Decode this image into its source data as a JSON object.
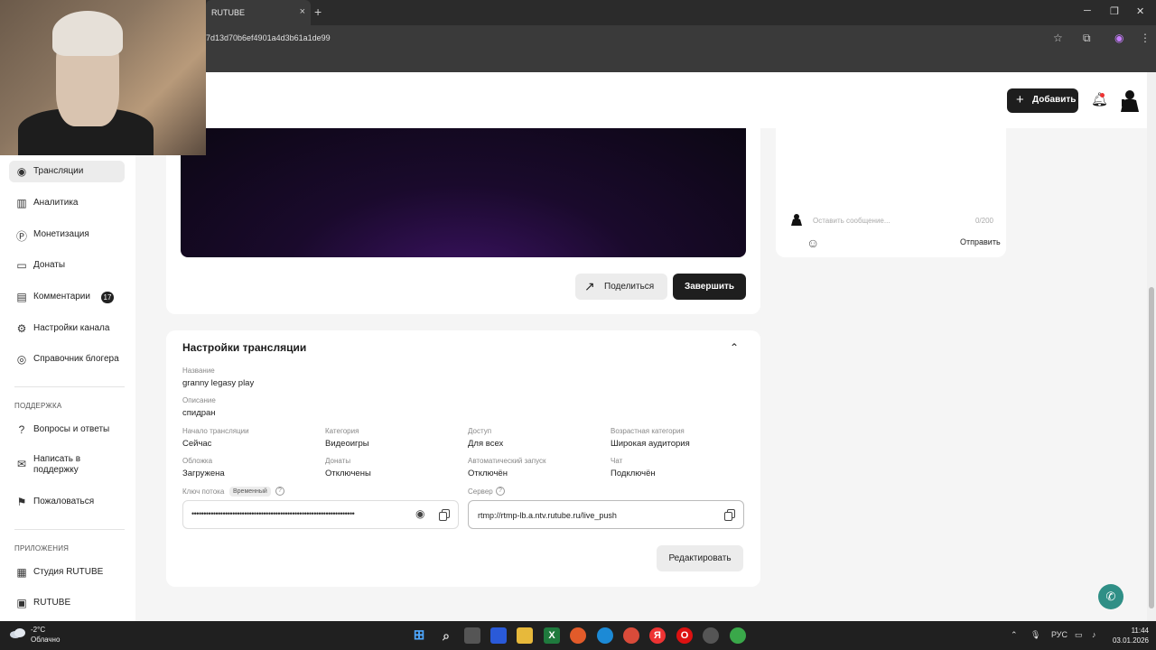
{
  "browser": {
    "tab_title": "RUTUBE",
    "url": "7d13d70b6ef4901a4d3b61a1de99",
    "new_tab": "+",
    "close_tab": "×",
    "minimize": "─",
    "maximize": "❐",
    "close_window": "✕"
  },
  "header": {
    "add_label": "Добавить"
  },
  "sidebar": {
    "items": [
      {
        "label": "Трансляции",
        "icon": "broadcast-icon"
      },
      {
        "label": "Аналитика",
        "icon": "chart-icon"
      },
      {
        "label": "Монетизация",
        "icon": "coin-icon"
      },
      {
        "label": "Донаты",
        "icon": "wallet-icon"
      },
      {
        "label": "Комментарии",
        "icon": "comment-icon",
        "badge": "17"
      },
      {
        "label": "Настройки канала",
        "icon": "gear-icon"
      },
      {
        "label": "Справочник блогера",
        "icon": "book-icon"
      }
    ],
    "support_section": "ПОДДЕРЖКА",
    "support_items": [
      {
        "label": "Вопросы и ответы",
        "icon": "question-icon"
      },
      {
        "label": "Написать в поддержку",
        "icon": "mail-icon"
      },
      {
        "label": "Пожаловаться",
        "icon": "flag-icon"
      }
    ],
    "apps_section": "ПРИЛОЖЕНИЯ",
    "apps_items": [
      {
        "label": "Студия RUTUBE",
        "icon": "grid-icon"
      },
      {
        "label": "RUTUBE",
        "icon": "play-icon"
      }
    ]
  },
  "player": {
    "share_label": "Поделиться",
    "finish_label": "Завершить"
  },
  "chat": {
    "placeholder": "Оставить сообщение...",
    "counter": "0/200",
    "send_label": "Отправить"
  },
  "settings": {
    "title": "Настройки трансляции",
    "name_label": "Название",
    "name_value": "granny legasy play",
    "description_label": "Описание",
    "description_value": "спидран",
    "fields": [
      {
        "label": "Начало трансляции",
        "value": "Сейчас"
      },
      {
        "label": "Категория",
        "value": "Видеоигры"
      },
      {
        "label": "Доступ",
        "value": "Для всех"
      },
      {
        "label": "Возрастная категория",
        "value": "Широкая аудитория"
      },
      {
        "label": "Обложка",
        "value": "Загружена"
      },
      {
        "label": "Донаты",
        "value": "Отключены"
      },
      {
        "label": "Автоматический запуск",
        "value": "Отключён"
      },
      {
        "label": "Чат",
        "value": "Подключён"
      }
    ],
    "stream_key_label": "Ключ потока",
    "stream_key_tag": "Временный",
    "stream_key_value": "••••••••••••••••••••••••••••••••••••••••••••••••••••••••••••••••••••",
    "server_label": "Сервер",
    "server_value": "rtmp://rtmp-lb.a.ntv.rutube.ru/live_push",
    "edit_label": "Редактировать"
  },
  "taskbar": {
    "temperature": "-2°C",
    "weather": "Облачно",
    "language": "РУС",
    "time": "11:44",
    "date": "03.01.2026"
  },
  "colors": {
    "accent_dark": "#1e1e1e",
    "support_fab": "#2f8f86",
    "video_purple": "#3b1262"
  }
}
